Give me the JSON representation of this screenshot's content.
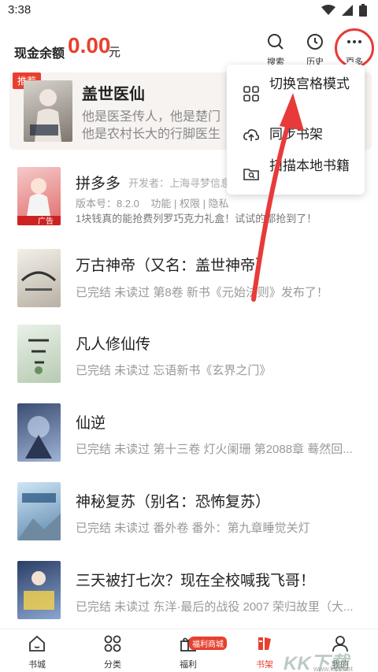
{
  "status_bar": {
    "time": "3:38"
  },
  "header": {
    "balance_label": "现金余额",
    "balance_amount": "0.00",
    "balance_unit": "元",
    "search_label": "搜索",
    "history_label": "历史",
    "more_label": "更多"
  },
  "featured": {
    "tag": "推荐",
    "title": "盖世医仙",
    "desc_line1": "他是医圣传人，他是楚门",
    "desc_line2": "他是农村长大的行脚医生"
  },
  "popup_menu": {
    "items": [
      {
        "label": "切换宫格模式",
        "icon": "grid-icon"
      },
      {
        "label": "同步书架",
        "icon": "cloud-sync-icon"
      },
      {
        "label": "扫描本地书籍",
        "icon": "folder-search-icon"
      }
    ]
  },
  "books": [
    {
      "title": "拼多多",
      "developer": "开发者：上海寻梦信息",
      "meta": "版本号：8.2.0    功能 | 权限 | 隐私",
      "sub": "1块钱真的能抢费列罗巧克力礼盒！试试的都抢到了！",
      "badge": "广告"
    },
    {
      "title": "万古神帝（又名：盖世神帝）",
      "sub": "已完结 未读过 第8卷 新书《元始法则》发布了！"
    },
    {
      "title": "凡人修仙传",
      "sub": "已完结 未读过 忘语新书《玄界之门》"
    },
    {
      "title": "仙逆",
      "sub": "已完结 未读过 第十三卷 灯火阑珊 第2088章 蓦然回..."
    },
    {
      "title": "神秘复苏（别名：恐怖复苏）",
      "sub": "已完结 未读过 番外卷 番外：第九章睡觉关灯"
    },
    {
      "title": "三天被打七次？现在全校喊我飞哥！",
      "sub": "已完结 未读过 东洋·最后的战役 2007 荣归故里（大..."
    }
  ],
  "bottom_nav": {
    "items": [
      {
        "label": "书城",
        "icon": "home-icon"
      },
      {
        "label": "分类",
        "icon": "category-icon"
      },
      {
        "label": "福利",
        "icon": "gift-icon"
      },
      {
        "label": "书架",
        "icon": "bookshelf-icon"
      },
      {
        "label": "我的",
        "icon": "profile-icon"
      }
    ],
    "active": "书架",
    "welfare_badge": "福利商城"
  },
  "watermark": {
    "main": "KK下载",
    "url": "www.kkx.net"
  },
  "colors": {
    "accent": "#e8402f",
    "annotation_red": "#e83a3a"
  }
}
